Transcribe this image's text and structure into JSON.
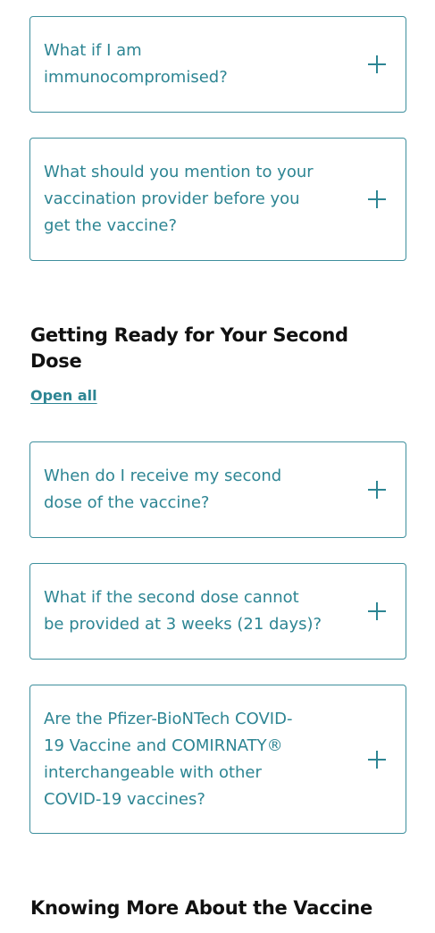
{
  "faq_section_1": {
    "items": [
      {
        "question": "What if I am\nimmunocompromised?",
        "icon": "plus-icon"
      },
      {
        "question": "What should you mention to your\nvaccination provider before you\nget the vaccine?",
        "icon": "plus-icon"
      }
    ]
  },
  "second_dose_section": {
    "heading": "Getting Ready for Your Second\nDose",
    "open_all_label": "Open all",
    "items": [
      {
        "question": "When do I receive my second\ndose of the vaccine?",
        "icon": "plus-icon"
      },
      {
        "question": "What if the second dose cannot\nbe provided at 3 weeks (21 days)?",
        "icon": "plus-icon"
      },
      {
        "question": "Are the Pfizer-BioNTech COVID-\n19 Vaccine and COMIRNATY®\ninterchangeable with other\nCOVID-19 vaccines?",
        "icon": "plus-icon"
      }
    ]
  },
  "knowing_more_section": {
    "heading": "Knowing More About the Vaccine"
  },
  "colors": {
    "accent": "#2d8593",
    "border": "#3e8f9d",
    "heading": "#111111",
    "background": "#ffffff"
  }
}
